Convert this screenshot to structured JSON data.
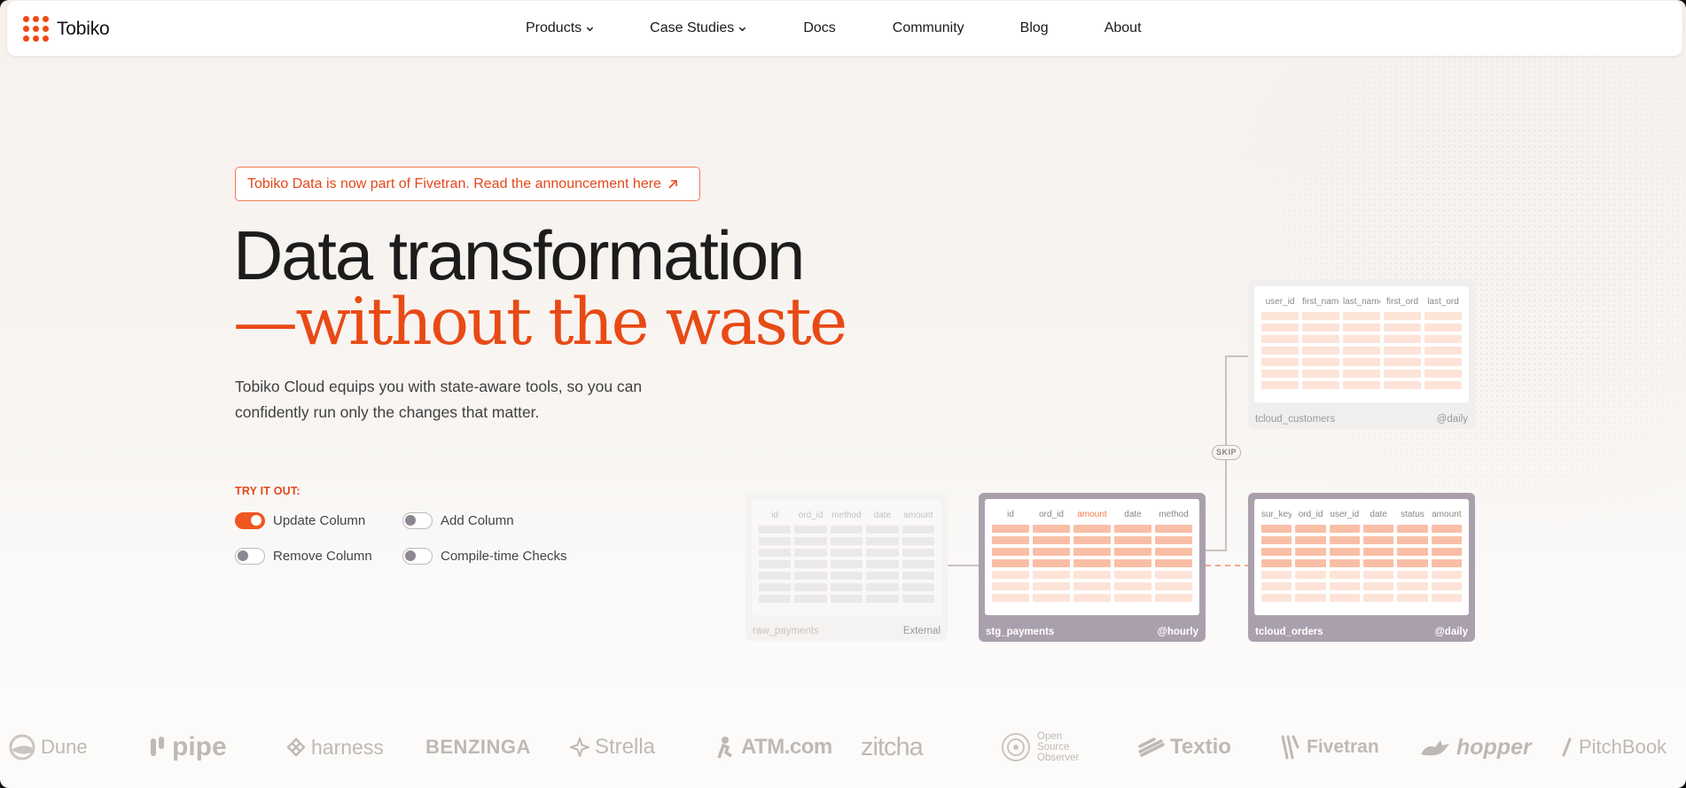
{
  "brand": {
    "name": "Tobiko",
    "accent": "#f04a16"
  },
  "nav": {
    "products": "Products",
    "case_studies": "Case Studies",
    "docs": "Docs",
    "community": "Community",
    "blog": "Blog",
    "about": "About"
  },
  "hero": {
    "announcement": "Tobiko Data is now part of Fivetran. Read the announcement here",
    "title_line1": "Data transformation",
    "title_line2": "—without the waste",
    "subtitle": "Tobiko Cloud equips you with state-aware tools, so you can confidently run only the changes that matter."
  },
  "try_it": {
    "label": "TRY IT OUT:",
    "options": [
      {
        "label": "Update Column",
        "on": true
      },
      {
        "label": "Add Column",
        "on": false
      },
      {
        "label": "Remove Column",
        "on": false
      },
      {
        "label": "Compile-time Checks",
        "on": false
      }
    ]
  },
  "diagram": {
    "skip_label": "SKIP",
    "raw_payments": {
      "name": "raw_payments",
      "schedule": "External",
      "columns": [
        "id",
        "ord_id",
        "method",
        "date",
        "amount"
      ]
    },
    "stg_payments": {
      "name": "stg_payments",
      "schedule": "@hourly",
      "columns": [
        "id",
        "ord_id",
        "amount",
        "date",
        "method"
      ],
      "highlight_column": "amount"
    },
    "tcloud_orders": {
      "name": "tcloud_orders",
      "schedule": "@daily",
      "columns": [
        "sur_key",
        "ord_id",
        "user_id",
        "date",
        "status",
        "amount"
      ]
    },
    "tcloud_customers": {
      "name": "tcloud_customers",
      "schedule": "@daily",
      "columns": [
        "user_id",
        "first_name",
        "last_name",
        "first_ord",
        "last_ord"
      ]
    }
  },
  "logos": [
    "Dune",
    "pipe",
    "harness",
    "BENZINGA",
    "Strella",
    "ATM.com",
    "zitcha",
    "Open Source Observer",
    "Textio",
    "Fivetran",
    "hopper",
    "PitchBook"
  ]
}
